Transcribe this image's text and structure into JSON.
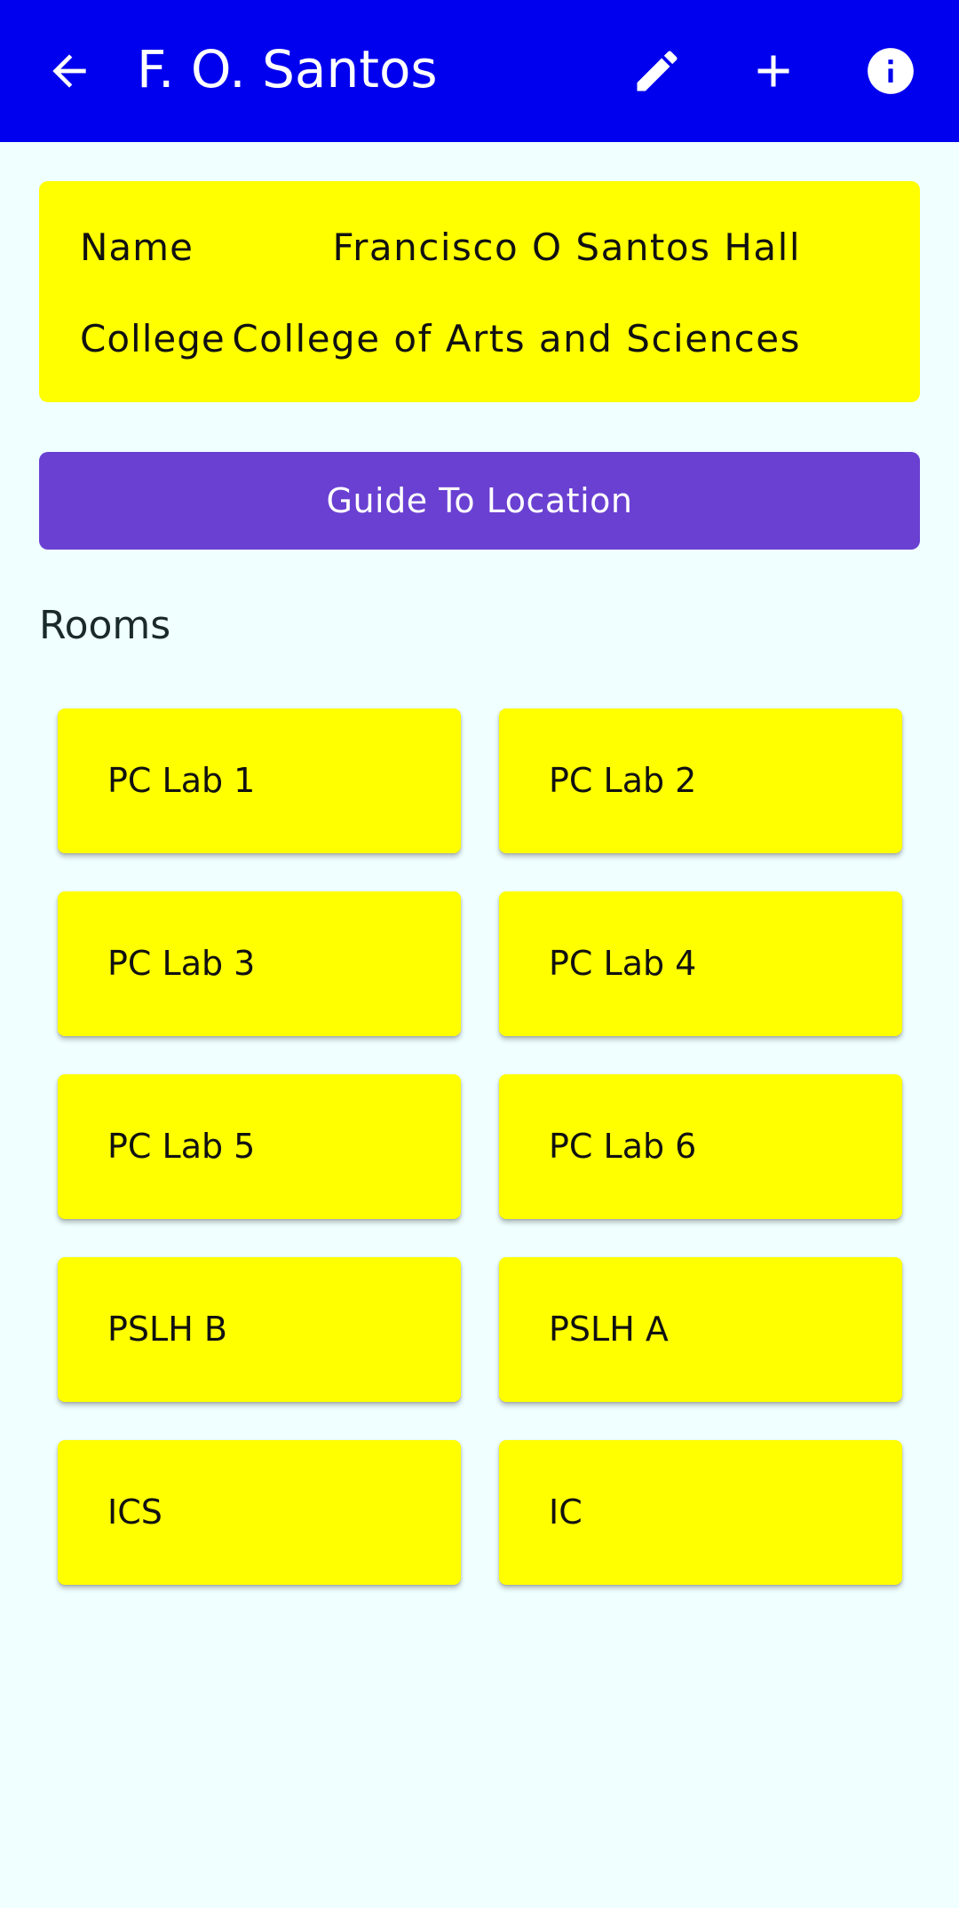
{
  "app_bar": {
    "title": "F. O. Santos",
    "back_icon": "arrow-left-icon",
    "edit_icon": "pencil-icon",
    "add_icon": "plus-icon",
    "info_icon": "info-circle-icon",
    "background_color": "#0000EE"
  },
  "building": {
    "name_label": "Name",
    "name_value": "Francisco O Santos Hall",
    "college_label": "College",
    "college_value": "College of Arts and Sciences",
    "card_color": "#FFFF00"
  },
  "guide_button": {
    "label": "Guide To Location",
    "color": "#6A40D2"
  },
  "rooms": {
    "title": "Rooms",
    "items": [
      {
        "label": "PC Lab 1"
      },
      {
        "label": "PC Lab 2"
      },
      {
        "label": "PC Lab 3"
      },
      {
        "label": "PC Lab 4"
      },
      {
        "label": "PC Lab 5"
      },
      {
        "label": "PC Lab 6"
      },
      {
        "label": "PSLH B"
      },
      {
        "label": "PSLH A"
      },
      {
        "label": "ICS"
      },
      {
        "label": "IC"
      }
    ]
  }
}
